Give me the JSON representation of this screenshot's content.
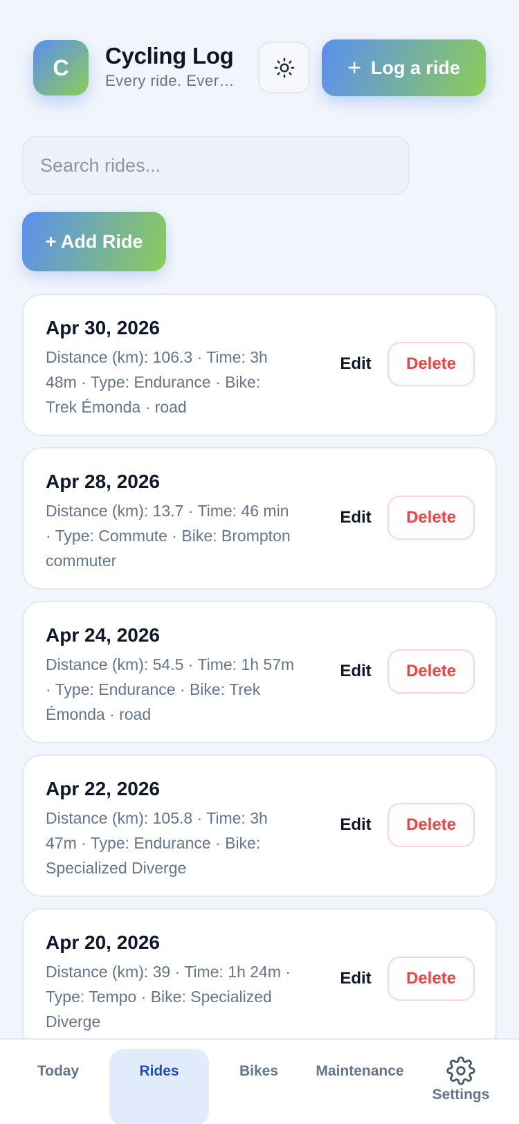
{
  "header": {
    "logo_letter": "C",
    "title": "Cycling Log",
    "subtitle": "Every ride. Every mile.",
    "theme_toggle_icon": "sun-icon",
    "log_ride_label": "Log a ride"
  },
  "search": {
    "placeholder": "Search rides...",
    "value": ""
  },
  "add_ride_label": "+ Add Ride",
  "rides": [
    {
      "date": "Apr 30, 2026",
      "meta": "Distance (km): 106.3 · Time: 3h 48m · Type: Endurance · Bike: Trek Émonda · road",
      "edit_label": "Edit",
      "delete_label": "Delete"
    },
    {
      "date": "Apr 28, 2026",
      "meta": "Distance (km): 13.7 · Time: 46 min · Type: Commute · Bike: Brompton commuter",
      "edit_label": "Edit",
      "delete_label": "Delete"
    },
    {
      "date": "Apr 24, 2026",
      "meta": "Distance (km): 54.5 · Time: 1h 57m · Type: Endurance · Bike: Trek Émonda · road",
      "edit_label": "Edit",
      "delete_label": "Delete"
    },
    {
      "date": "Apr 22, 2026",
      "meta": "Distance (km): 105.8 · Time: 3h 47m · Type: Endurance · Bike: Specialized Diverge",
      "edit_label": "Edit",
      "delete_label": "Delete"
    },
    {
      "date": "Apr 20, 2026",
      "meta": "Distance (km): 39 · Time: 1h 24m · Type: Tempo · Bike: Specialized Diverge",
      "edit_label": "Edit",
      "delete_label": "Delete"
    }
  ],
  "nav": {
    "today": "Today",
    "rides": "Rides",
    "bikes": "Bikes",
    "maintenance": "Maintenance",
    "settings": "Settings",
    "active": "Rides"
  },
  "colors": {
    "accent_start": "#5a8ff0",
    "accent_end": "#8ccc59",
    "danger": "#ef4444",
    "active_nav": "#1e4fb8"
  }
}
